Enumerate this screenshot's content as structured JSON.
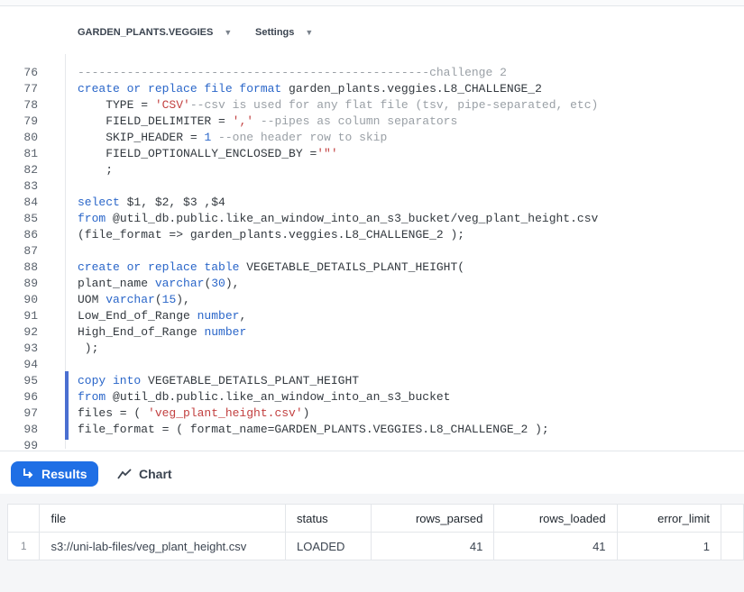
{
  "header": {
    "database_crumb": "GARDEN_PLANTS.VEGGIES",
    "settings_label": "Settings"
  },
  "editor": {
    "lines": [
      {
        "n": "76",
        "tokens": [
          {
            "t": "cm",
            "v": "--------------------------------------------------challenge 2"
          }
        ]
      },
      {
        "n": "77",
        "tokens": [
          {
            "t": "kw",
            "v": "create or replace file format "
          },
          {
            "t": "",
            "v": "garden_plants.veggies.L8_CHALLENGE_2"
          }
        ]
      },
      {
        "n": "78",
        "tokens": [
          {
            "t": "",
            "v": "    TYPE = "
          },
          {
            "t": "str",
            "v": "'CSV'"
          },
          {
            "t": "cm",
            "v": "--csv is used for any flat file (tsv, pipe-separated, etc)"
          }
        ]
      },
      {
        "n": "79",
        "tokens": [
          {
            "t": "",
            "v": "    FIELD_DELIMITER = "
          },
          {
            "t": "str",
            "v": "','"
          },
          {
            "t": "cm",
            "v": " --pipes as column separators"
          }
        ]
      },
      {
        "n": "80",
        "tokens": [
          {
            "t": "",
            "v": "    SKIP_HEADER = "
          },
          {
            "t": "num",
            "v": "1"
          },
          {
            "t": "cm",
            "v": " --one header row to skip"
          }
        ]
      },
      {
        "n": "81",
        "tokens": [
          {
            "t": "",
            "v": "    FIELD_OPTIONALLY_ENCLOSED_BY ="
          },
          {
            "t": "str",
            "v": "'\"'"
          }
        ]
      },
      {
        "n": "82",
        "tokens": [
          {
            "t": "",
            "v": "    ;"
          }
        ]
      },
      {
        "n": "83",
        "tokens": []
      },
      {
        "n": "84",
        "tokens": [
          {
            "t": "kw",
            "v": "select "
          },
          {
            "t": "",
            "v": "$1, $2, $3 ,$4"
          }
        ]
      },
      {
        "n": "85",
        "tokens": [
          {
            "t": "kw",
            "v": "from "
          },
          {
            "t": "",
            "v": "@util_db.public.like_an_window_into_an_s3_bucket/veg_plant_height.csv"
          }
        ]
      },
      {
        "n": "86",
        "tokens": [
          {
            "t": "",
            "v": "(file_format => garden_plants.veggies.L8_CHALLENGE_2 );"
          }
        ]
      },
      {
        "n": "87",
        "tokens": []
      },
      {
        "n": "88",
        "tokens": [
          {
            "t": "kw",
            "v": "create or replace table "
          },
          {
            "t": "",
            "v": "VEGETABLE_DETAILS_PLANT_HEIGHT("
          }
        ]
      },
      {
        "n": "89",
        "tokens": [
          {
            "t": "",
            "v": "plant_name "
          },
          {
            "t": "kw",
            "v": "varchar"
          },
          {
            "t": "",
            "v": "("
          },
          {
            "t": "num",
            "v": "30"
          },
          {
            "t": "",
            "v": "),"
          }
        ]
      },
      {
        "n": "90",
        "tokens": [
          {
            "t": "",
            "v": "UOM "
          },
          {
            "t": "kw",
            "v": "varchar"
          },
          {
            "t": "",
            "v": "("
          },
          {
            "t": "num",
            "v": "15"
          },
          {
            "t": "",
            "v": "),"
          }
        ]
      },
      {
        "n": "91",
        "tokens": [
          {
            "t": "",
            "v": "Low_End_of_Range "
          },
          {
            "t": "kw",
            "v": "number"
          },
          {
            "t": "",
            "v": ","
          }
        ]
      },
      {
        "n": "92",
        "tokens": [
          {
            "t": "",
            "v": "High_End_of_Range "
          },
          {
            "t": "kw",
            "v": "number"
          }
        ]
      },
      {
        "n": "93",
        "tokens": [
          {
            "t": "",
            "v": " );"
          }
        ]
      },
      {
        "n": "94",
        "tokens": []
      },
      {
        "n": "95",
        "tokens": [
          {
            "t": "kw",
            "v": "copy into "
          },
          {
            "t": "",
            "v": "VEGETABLE_DETAILS_PLANT_HEIGHT"
          }
        ]
      },
      {
        "n": "96",
        "tokens": [
          {
            "t": "kw",
            "v": "from "
          },
          {
            "t": "",
            "v": "@util_db.public.like_an_window_into_an_s3_bucket"
          }
        ]
      },
      {
        "n": "97",
        "tokens": [
          {
            "t": "",
            "v": "files = ( "
          },
          {
            "t": "str",
            "v": "'veg_plant_height.csv'"
          },
          {
            "t": "",
            "v": ")"
          }
        ]
      },
      {
        "n": "98",
        "tokens": [
          {
            "t": "",
            "v": "file_format = ( format_name=GARDEN_PLANTS.VEGGIES.L8_CHALLENGE_2 );"
          }
        ]
      },
      {
        "n": "99",
        "tokens": []
      }
    ]
  },
  "tabs": {
    "results_label": "Results",
    "chart_label": "Chart"
  },
  "results": {
    "columns": [
      "file",
      "status",
      "rows_parsed",
      "rows_loaded",
      "error_limit"
    ],
    "rows": [
      {
        "index": "1",
        "file": "s3://uni-lab-files/veg_plant_height.csv",
        "status": "LOADED",
        "rows_parsed": "41",
        "rows_loaded": "41",
        "error_limit": "1"
      }
    ]
  },
  "colors": {
    "accent": "#1f6fe5",
    "keyword": "#2a66c9",
    "string": "#c24040",
    "comment": "#9aa0a6",
    "selection_bar": "#4a6fd1"
  }
}
